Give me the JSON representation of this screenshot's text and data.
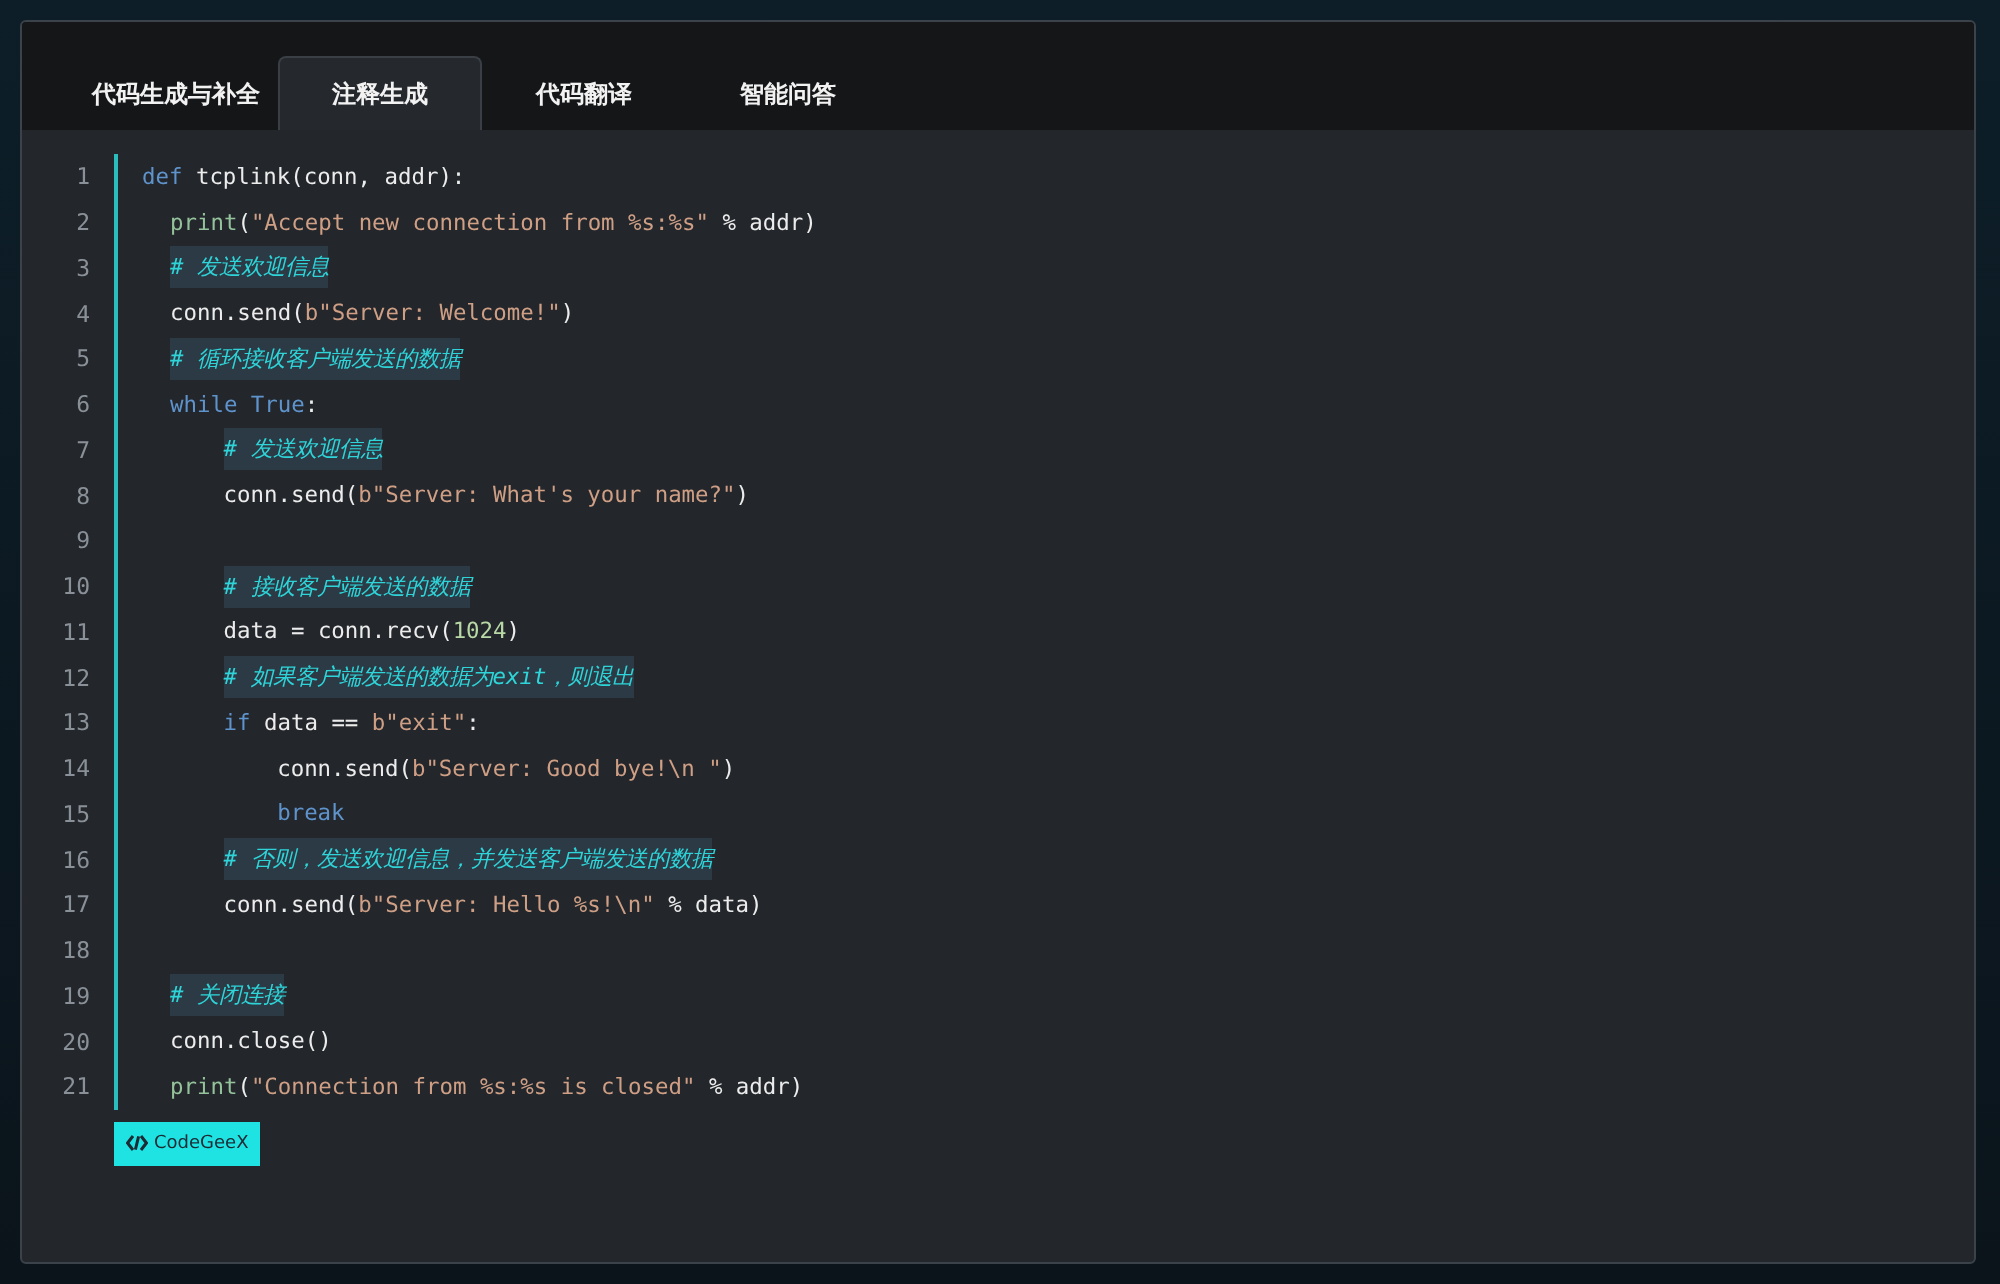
{
  "tabs": [
    {
      "label": "代码生成与补全",
      "selected": false
    },
    {
      "label": "注释生成",
      "selected": true
    },
    {
      "label": "代码翻译",
      "selected": false
    },
    {
      "label": "智能问答",
      "selected": false
    }
  ],
  "code": {
    "lines": [
      {
        "number": "1",
        "tokens": [
          {
            "kind": "keyword",
            "text": "def"
          },
          {
            "kind": "plain",
            "text": " tcplink(conn, addr):"
          }
        ],
        "children": [
          {
            "number": "2",
            "tokens": [
              {
                "kind": "builtin",
                "text": "print"
              },
              {
                "kind": "plain",
                "text": "("
              },
              {
                "kind": "string",
                "text": "\"Accept new connection from %s:%s\""
              },
              {
                "kind": "plain",
                "text": " % addr)"
              }
            ]
          },
          {
            "number": "3",
            "tokens": [
              {
                "kind": "comment",
                "text": "# 发送欢迎信息"
              }
            ]
          },
          {
            "number": "4",
            "tokens": [
              {
                "kind": "plain",
                "text": "conn.send("
              },
              {
                "kind": "string",
                "text": "b\"Server: Welcome!\""
              },
              {
                "kind": "plain",
                "text": ")"
              }
            ]
          },
          {
            "number": "5",
            "tokens": [
              {
                "kind": "comment",
                "text": "# 循环接收客户端发送的数据"
              }
            ]
          },
          {
            "number": "6",
            "tokens": [
              {
                "kind": "keyword",
                "text": "while True"
              },
              {
                "kind": "plain",
                "text": ":"
              }
            ],
            "children": [
              {
                "number": "7",
                "tokens": [
                  {
                    "kind": "comment",
                    "text": "# 发送欢迎信息"
                  }
                ]
              },
              {
                "number": "8",
                "tokens": [
                  {
                    "kind": "plain",
                    "text": "conn.send("
                  },
                  {
                    "kind": "string",
                    "text": "b\"Server: What's your name?\""
                  },
                  {
                    "kind": "plain",
                    "text": ")"
                  }
                ]
              },
              {
                "number": "9"
              },
              {
                "number": "10",
                "tokens": [
                  {
                    "kind": "comment",
                    "text": "# 接收客户端发送的数据"
                  }
                ]
              },
              {
                "number": "11",
                "tokens": [
                  {
                    "kind": "plain",
                    "text": "data = conn.recv("
                  },
                  {
                    "kind": "number",
                    "text": "1024"
                  },
                  {
                    "kind": "plain",
                    "text": ")"
                  }
                ]
              },
              {
                "number": "12",
                "tokens": [
                  {
                    "kind": "comment",
                    "text": "# 如果客户端发送的数据为exit，则退出"
                  }
                ]
              },
              {
                "number": "13",
                "tokens": [
                  {
                    "kind": "keyword",
                    "text": "if"
                  },
                  {
                    "kind": "plain",
                    "text": " data == "
                  },
                  {
                    "kind": "string",
                    "text": "b\"exit\""
                  },
                  {
                    "kind": "plain",
                    "text": ":"
                  }
                ],
                "children": [
                  {
                    "number": "14",
                    "tokens": [
                      {
                        "kind": "plain",
                        "text": "conn.send("
                      },
                      {
                        "kind": "string",
                        "text": "b\"Server: Good bye!\\n \""
                      },
                      {
                        "kind": "plain",
                        "text": ")"
                      }
                    ]
                  },
                  {
                    "number": "15",
                    "tokens": [
                      {
                        "kind": "keyword",
                        "text": "break"
                      }
                    ]
                  }
                ]
              },
              {
                "number": "16",
                "tokens": [
                  {
                    "kind": "comment",
                    "text": "# 否则，发送欢迎信息，并发送客户端发送的数据"
                  }
                ]
              },
              {
                "number": "17",
                "tokens": [
                  {
                    "kind": "plain",
                    "text": "conn.send("
                  },
                  {
                    "kind": "string",
                    "text": "b\"Server: Hello %s!\\n\""
                  },
                  {
                    "kind": "plain",
                    "text": " % data)"
                  }
                ]
              }
            ]
          },
          {
            "number": "18"
          },
          {
            "number": "19",
            "tokens": [
              {
                "kind": "comment",
                "text": "# 关闭连接"
              }
            ]
          },
          {
            "number": "20",
            "tokens": [
              {
                "kind": "plain",
                "text": "conn.close()"
              }
            ]
          },
          {
            "number": "21",
            "tokens": [
              {
                "kind": "builtin",
                "text": "print"
              },
              {
                "kind": "plain",
                "text": "("
              },
              {
                "kind": "string",
                "text": "\"Connection from %s:%s is closed\""
              },
              {
                "kind": "plain",
                "text": " % addr)"
              }
            ]
          }
        ]
      }
    ]
  },
  "badge": {
    "label": "CodeGeeX"
  }
}
